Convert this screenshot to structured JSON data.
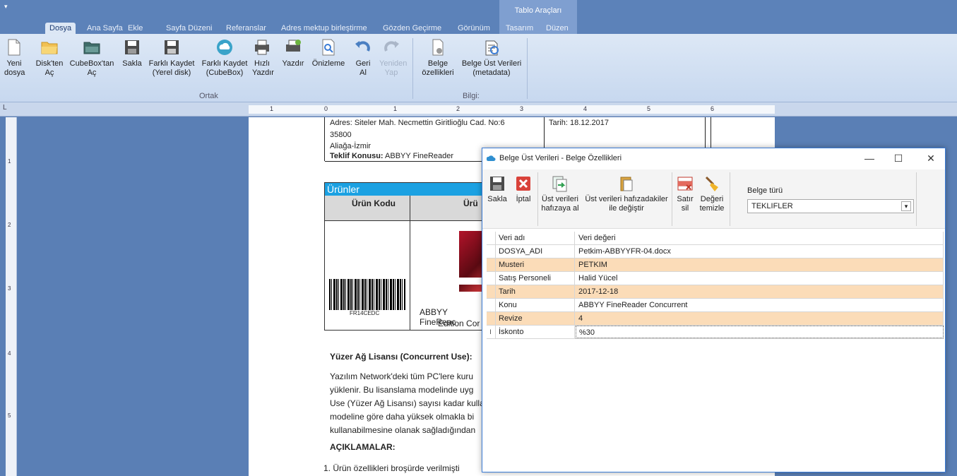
{
  "ribbon_tabs": {
    "file_icon": "▤▾",
    "tabs": [
      "Dosya",
      "Ana Sayfa",
      "Ekle",
      "Sayfa Düzeni",
      "Referanslar",
      "Adres mektup birleştirme",
      "Gözden Geçirme",
      "Görünüm"
    ],
    "context_header": "Tablo Araçları",
    "context_tabs": [
      "Tasarım",
      "Düzen"
    ],
    "active": "Dosya"
  },
  "ribbon": {
    "buttons": [
      {
        "l1": "Yeni",
        "l2": "dosya",
        "icon": "new-document-icon"
      },
      {
        "l1": "Disk'ten",
        "l2": "Aç",
        "icon": "open-folder-icon"
      },
      {
        "l1": "CubeBox'tan",
        "l2": "Aç",
        "icon": "cloud-folder-icon"
      },
      {
        "l1": "Sakla",
        "l2": "",
        "icon": "save-icon"
      },
      {
        "l1": "Farklı Kaydet",
        "l2": "(Yerel disk)",
        "icon": "save-as-icon"
      },
      {
        "l1": "Farklı Kaydet",
        "l2": "(CubeBox)",
        "icon": "cloud-save-icon"
      },
      {
        "l1": "Hızlı",
        "l2": "Yazdır",
        "icon": "quick-print-icon"
      },
      {
        "l1": "Yazdır",
        "l2": "",
        "icon": "print-icon"
      },
      {
        "l1": "Önizleme",
        "l2": "",
        "icon": "preview-icon"
      },
      {
        "l1": "Geri",
        "l2": "Al",
        "icon": "undo-icon"
      },
      {
        "l1": "Yeniden",
        "l2": "Yap",
        "icon": "redo-icon"
      },
      {
        "l1": "Belge",
        "l2": "özellikleri",
        "icon": "document-properties-icon"
      },
      {
        "l1": "Belge Üst Verileri",
        "l2": "(metadata)",
        "icon": "metadata-icon"
      }
    ],
    "group_common": "Ortak",
    "group_info": "Bilgi:"
  },
  "ruler": {
    "corner": "L",
    "ticks": [
      "1",
      "0",
      "1",
      "2",
      "3",
      "4",
      "5",
      "6"
    ],
    "vticks": [
      "1",
      "2",
      "3",
      "4",
      "5"
    ]
  },
  "document": {
    "address": "Adres: Siteler Mah. Necmettin Giritlioğlu Cad. No:6",
    "postcode": "35800",
    "city": "Aliağa-İzmir",
    "subject_label": "Teklif Konusu:",
    "subject_value": "ABBYY FineReader",
    "date": "Tarih: 18.12.2017",
    "products_title": "Ürünler",
    "col_code": "Ürün Kodu",
    "col_name": "Ürü",
    "barcode_text": "FR14CEDC",
    "prod_name1": "ABBYY FineReac",
    "prod_name2": "Edition Cor",
    "section_title": "Yüzer Ağ Lisansı (Concurrent Use):",
    "para": [
      "Yazılım Network'deki tüm PC'lere kuru",
      "yüklenir. Bu lisanslama modelinde uyg",
      "Use (Yüzer Ağ Lisansı) sayısı kadar kulla",
      "modeline göre daha yüksek olmakla bi",
      "kullanabilmesine olanak sağladığından"
    ],
    "notes_title": "AÇIKLAMALAR:",
    "note1": "1.   Ürün özellikleri broşürde verilmişti"
  },
  "dialog": {
    "title": "Belge Üst Verileri - Belge Özellikleri",
    "minimize": "—",
    "maximize": "☐",
    "close": "✕",
    "toolbar": {
      "save": "Sakla",
      "cancel": "İptal",
      "copy_l1": "Üst verileri",
      "copy_l2": "hafızaya al",
      "replace_l1": "Üst verileri hafızadakiler",
      "replace_l2": "ile değiştir",
      "delrow_l1": "Satır",
      "delrow_l2": "sil",
      "clear_l1": "Değeri",
      "clear_l2": "temizle"
    },
    "doc_type_label": "Belge türü",
    "doc_type_value": "TEKLIFLER",
    "grid_header": {
      "name": "Veri adı",
      "value": "Veri değeri"
    },
    "rows": [
      {
        "name": "DOSYA_ADI",
        "value": "Petkim-ABBYYFR-04.docx",
        "alt": false
      },
      {
        "name": "Musteri",
        "value": "PETKIM",
        "alt": true
      },
      {
        "name": "Satış Personeli",
        "value": "Halid Yücel",
        "alt": false
      },
      {
        "name": "Tarih",
        "value": "2017-12-18",
        "alt": true
      },
      {
        "name": "Konu",
        "value": "ABBYY FineReader Concurrent",
        "alt": false
      },
      {
        "name": "Revize",
        "value": "4",
        "alt": true
      },
      {
        "name": "İskonto",
        "value": "%30",
        "alt": false,
        "editing": true
      }
    ],
    "edit_marker": "I"
  },
  "colors": {
    "ribbon_blue": "#5c82b9",
    "context_tab": "#7f9fd0",
    "products_header": "#1ba1e2",
    "alt_row": "#fbdcb8"
  }
}
